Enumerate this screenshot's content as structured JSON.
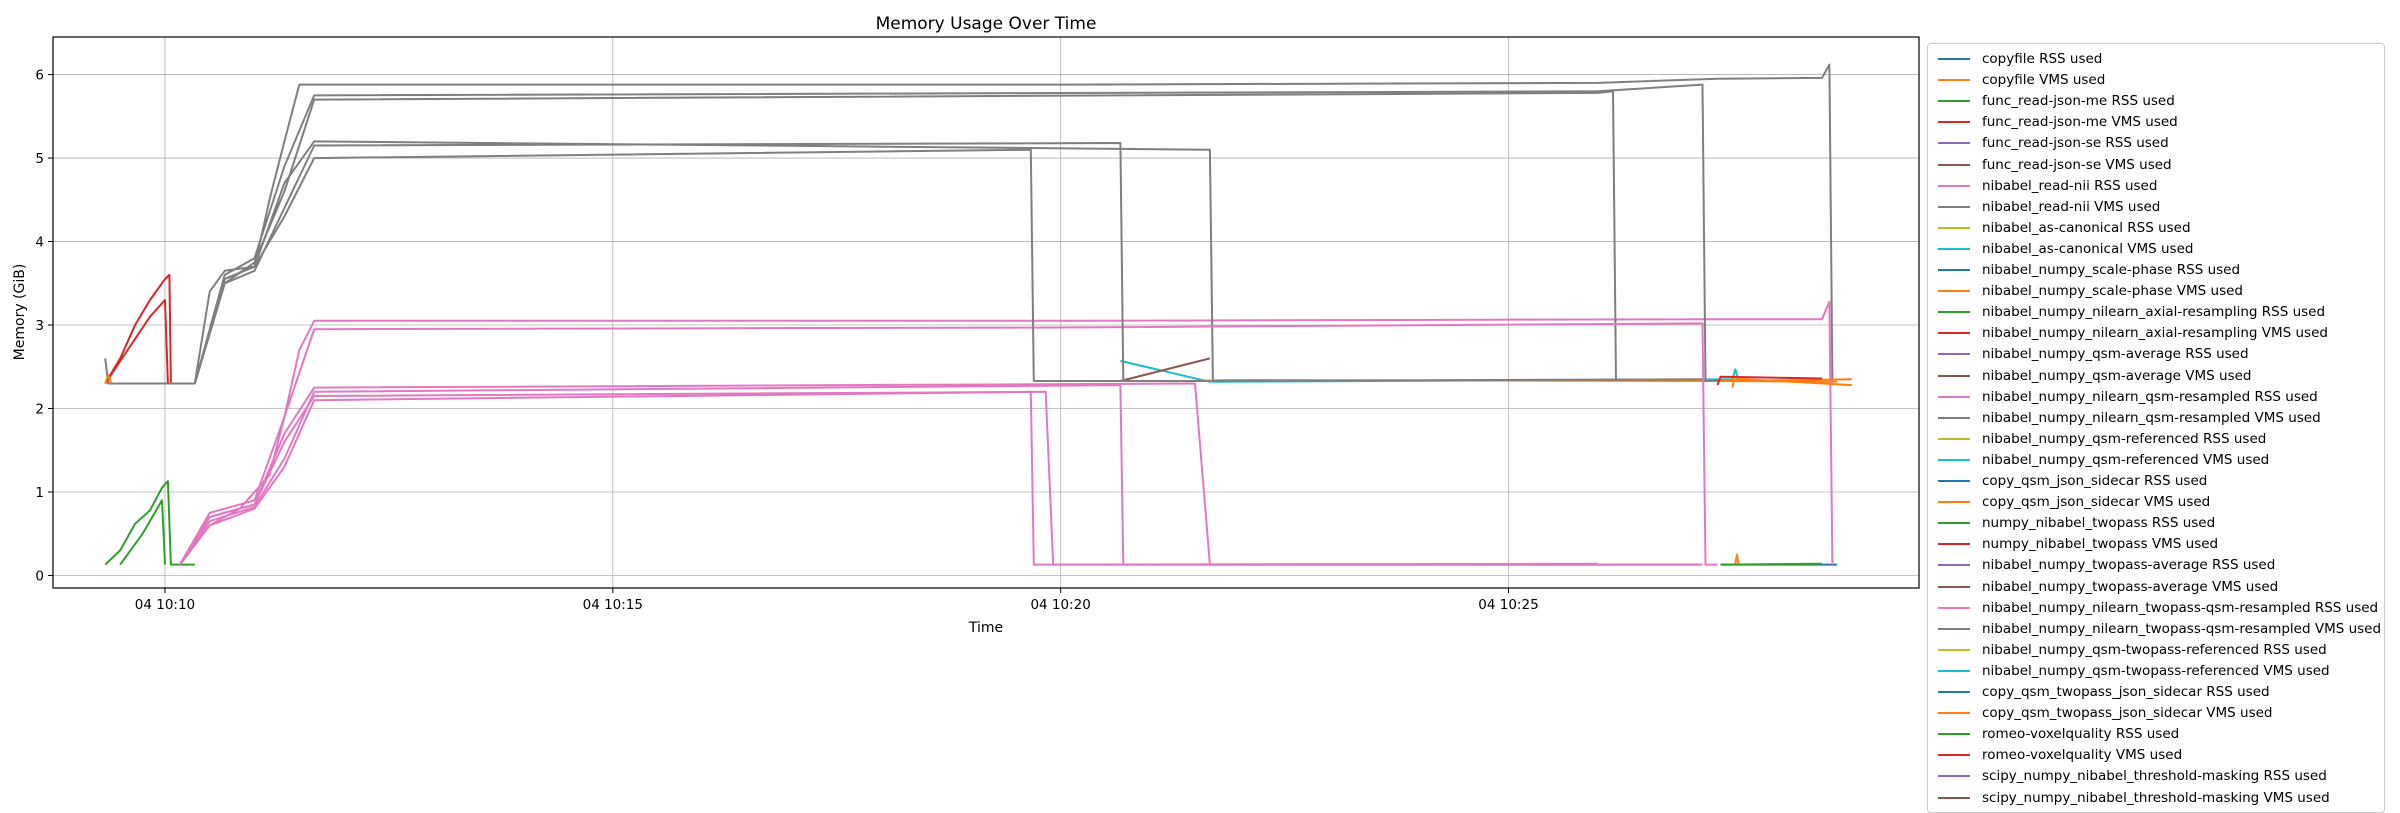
{
  "chart_data": {
    "type": "line",
    "title": "Memory Usage Over Time",
    "xlabel": "Time",
    "ylabel": "Memory (GiB)",
    "grid": true,
    "legend_placement": "outside-right",
    "xlim": [
      "04 10:08:45",
      "04 10:29:35"
    ],
    "ylim": [
      -0.15,
      6.45
    ],
    "xticks": [
      {
        "t": "04 10:10:00",
        "label": "04 10:10"
      },
      {
        "t": "04 10:15:00",
        "label": "04 10:15"
      },
      {
        "t": "04 10:20:00",
        "label": "04 10:20"
      },
      {
        "t": "04 10:25:00",
        "label": "04 10:25"
      }
    ],
    "yticks": [
      0,
      1,
      2,
      3,
      4,
      5,
      6
    ],
    "series": [
      {
        "name": "copyfile RSS used",
        "color": "#1f77b4",
        "points": [
          [
            "04 10:27:22",
            0.13
          ],
          [
            "04 10:28:40",
            0.13
          ]
        ]
      },
      {
        "name": "copyfile VMS used",
        "color": "#ff7f0e",
        "points": [
          [
            "04 10:27:22",
            2.33
          ],
          [
            "04 10:28:40",
            2.32
          ]
        ]
      },
      {
        "name": "func_read-json-me RSS used",
        "color": "#2ca02c",
        "points": [
          [
            "04 10:09:20",
            0.13
          ],
          [
            "04 10:09:30",
            0.3
          ],
          [
            "04 10:09:40",
            0.62
          ],
          [
            "04 10:09:50",
            0.78
          ],
          [
            "04 10:09:58",
            1.05
          ],
          [
            "04 10:10:02",
            1.13
          ],
          [
            "04 10:10:04",
            0.13
          ],
          [
            "04 10:10:20",
            0.13
          ]
        ]
      },
      {
        "name": "func_read-json-me VMS used",
        "color": "#d62728",
        "points": [
          [
            "04 10:09:20",
            2.3
          ],
          [
            "04 10:09:30",
            2.6
          ],
          [
            "04 10:09:40",
            3.0
          ],
          [
            "04 10:09:50",
            3.3
          ],
          [
            "04 10:10:00",
            3.55
          ],
          [
            "04 10:10:03",
            3.6
          ],
          [
            "04 10:10:04",
            2.3
          ],
          [
            "04 10:10:20",
            2.3
          ]
        ]
      },
      {
        "name": "func_read-json-se RSS used",
        "color": "#9467bd",
        "points": []
      },
      {
        "name": "func_read-json-se VMS used",
        "color": "#8c564b",
        "points": []
      },
      {
        "name": "nibabel_read-nii RSS used",
        "color": "#e377c2",
        "points": [
          [
            "04 10:10:10",
            0.13
          ],
          [
            "04 10:10:30",
            0.6
          ],
          [
            "04 10:10:50",
            0.8
          ],
          [
            "04 10:11:10",
            1.2
          ],
          [
            "04 10:11:20",
            1.9
          ],
          [
            "04 10:11:30",
            2.7
          ],
          [
            "04 10:11:40",
            3.05
          ],
          [
            "04 10:20:00",
            3.05
          ],
          [
            "04 10:27:20",
            3.07
          ],
          [
            "04 10:28:30",
            3.07
          ],
          [
            "04 10:28:35",
            3.28
          ],
          [
            "04 10:28:37",
            0.13
          ]
        ]
      },
      {
        "name": "nibabel_read-nii VMS used",
        "color": "#7f7f7f",
        "points": [
          [
            "04 10:09:20",
            2.6
          ],
          [
            "04 10:09:22",
            2.3
          ],
          [
            "04 10:10:20",
            2.3
          ],
          [
            "04 10:10:30",
            3.4
          ],
          [
            "04 10:10:40",
            3.65
          ],
          [
            "04 10:11:00",
            3.7
          ],
          [
            "04 10:11:10",
            4.5
          ],
          [
            "04 10:11:20",
            5.2
          ],
          [
            "04 10:11:30",
            5.88
          ],
          [
            "04 10:20:00",
            5.88
          ],
          [
            "04 10:26:00",
            5.9
          ],
          [
            "04 10:27:20",
            5.95
          ],
          [
            "04 10:28:30",
            5.96
          ],
          [
            "04 10:28:35",
            6.12
          ],
          [
            "04 10:28:37",
            2.33
          ]
        ]
      },
      {
        "name": "nibabel_as-canonical RSS used",
        "color": "#bcbd22",
        "points": []
      },
      {
        "name": "nibabel_as-canonical VMS used",
        "color": "#17becf",
        "points": [
          [
            "04 10:20:40",
            2.57
          ],
          [
            "04 10:21:40",
            2.32
          ],
          [
            "04 10:27:30",
            2.35
          ],
          [
            "04 10:27:32",
            2.47
          ],
          [
            "04 10:27:34",
            2.33
          ]
        ]
      },
      {
        "name": "nibabel_numpy_scale-phase RSS used",
        "color": "#1f77b4",
        "points": []
      },
      {
        "name": "nibabel_numpy_scale-phase VMS used",
        "color": "#ff7f0e",
        "points": [
          [
            "04 10:21:30",
            2.33
          ],
          [
            "04 10:21:50",
            2.34
          ],
          [
            "04 10:27:30",
            2.33
          ],
          [
            "04 10:28:50",
            2.35
          ]
        ]
      },
      {
        "name": "nibabel_numpy_nilearn_axial-resampling RSS used",
        "color": "#2ca02c",
        "points": []
      },
      {
        "name": "nibabel_numpy_nilearn_axial-resampling VMS used",
        "color": "#d62728",
        "points": [
          [
            "04 10:27:20",
            2.28
          ],
          [
            "04 10:27:22",
            2.38
          ],
          [
            "04 10:28:30",
            2.36
          ]
        ]
      },
      {
        "name": "nibabel_numpy_qsm-average RSS used",
        "color": "#9467bd",
        "points": []
      },
      {
        "name": "nibabel_numpy_qsm-average VMS used",
        "color": "#8c564b",
        "points": [
          [
            "04 10:20:40",
            2.33
          ],
          [
            "04 10:21:40",
            2.6
          ]
        ]
      },
      {
        "name": "nibabel_numpy_nilearn_qsm-resampled RSS used",
        "color": "#e377c2",
        "points": [
          [
            "04 10:10:10",
            0.13
          ],
          [
            "04 10:10:30",
            0.7
          ],
          [
            "04 10:11:00",
            0.85
          ],
          [
            "04 10:11:20",
            1.6
          ],
          [
            "04 10:11:40",
            2.15
          ],
          [
            "04 10:19:50",
            2.2
          ],
          [
            "04 10:19:55",
            0.13
          ],
          [
            "04 10:26:10",
            0.13
          ]
        ]
      },
      {
        "name": "nibabel_numpy_nilearn_qsm-resampled VMS used",
        "color": "#7f7f7f",
        "points": [
          [
            "04 10:10:20",
            2.3
          ],
          [
            "04 10:10:40",
            3.5
          ],
          [
            "04 10:11:00",
            3.75
          ],
          [
            "04 10:11:20",
            4.6
          ],
          [
            "04 10:11:40",
            5.7
          ],
          [
            "04 10:26:00",
            5.78
          ],
          [
            "04 10:26:10",
            5.8
          ],
          [
            "04 10:26:12",
            2.33
          ]
        ]
      },
      {
        "name": "nibabel_numpy_qsm-referenced RSS used",
        "color": "#bcbd22",
        "points": []
      },
      {
        "name": "nibabel_numpy_qsm-referenced VMS used",
        "color": "#17becf",
        "points": []
      },
      {
        "name": "copy_qsm_json_sidecar RSS used",
        "color": "#1f77b4",
        "points": []
      },
      {
        "name": "copy_qsm_json_sidecar VMS used",
        "color": "#ff7f0e",
        "points": [
          [
            "04 10:27:30",
            2.36
          ],
          [
            "04 10:28:50",
            2.28
          ]
        ]
      },
      {
        "name": "numpy_nibabel_twopass RSS used",
        "color": "#2ca02c",
        "points": []
      },
      {
        "name": "numpy_nibabel_twopass VMS used",
        "color": "#d62728",
        "points": []
      },
      {
        "name": "nibabel_numpy_twopass-average RSS used",
        "color": "#9467bd",
        "points": []
      },
      {
        "name": "nibabel_numpy_twopass-average VMS used",
        "color": "#8c564b",
        "points": []
      },
      {
        "name": "nibabel_numpy_nilearn_twopass-qsm-resampled RSS used",
        "color": "#e377c2",
        "points": [
          [
            "04 10:10:10",
            0.13
          ],
          [
            "04 10:10:30",
            0.7
          ],
          [
            "04 10:11:00",
            0.85
          ],
          [
            "04 10:11:20",
            1.7
          ],
          [
            "04 10:11:40",
            2.25
          ],
          [
            "04 10:21:30",
            2.3
          ],
          [
            "04 10:21:40",
            0.13
          ],
          [
            "04 10:27:10",
            0.13
          ]
        ]
      },
      {
        "name": "nibabel_numpy_nilearn_twopass-qsm-resampled VMS used",
        "color": "#7f7f7f",
        "points": [
          [
            "04 10:10:20",
            2.3
          ],
          [
            "04 10:10:40",
            3.55
          ],
          [
            "04 10:11:00",
            3.7
          ],
          [
            "04 10:11:20",
            4.7
          ],
          [
            "04 10:11:40",
            5.2
          ],
          [
            "04 10:21:40",
            5.1
          ],
          [
            "04 10:21:42",
            2.33
          ],
          [
            "04 10:27:10",
            2.35
          ]
        ]
      },
      {
        "name": "nibabel_numpy_qsm-twopass-referenced RSS used",
        "color": "#bcbd22",
        "points": []
      },
      {
        "name": "nibabel_numpy_qsm-twopass-referenced VMS used",
        "color": "#17becf",
        "points": []
      },
      {
        "name": "copy_qsm_twopass_json_sidecar RSS used",
        "color": "#1f77b4",
        "points": []
      },
      {
        "name": "copy_qsm_twopass_json_sidecar VMS used",
        "color": "#ff7f0e",
        "points": [
          [
            "04 10:27:30",
            2.25
          ],
          [
            "04 10:27:31",
            2.34
          ]
        ]
      },
      {
        "name": "romeo-voxelquality RSS used",
        "color": "#2ca02c",
        "points": [
          [
            "04 10:27:22",
            0.13
          ],
          [
            "04 10:28:30",
            0.14
          ]
        ]
      },
      {
        "name": "romeo-voxelquality VMS used",
        "color": "#d62728",
        "points": []
      },
      {
        "name": "scipy_numpy_nibabel_threshold-masking RSS used",
        "color": "#9467bd",
        "points": []
      },
      {
        "name": "scipy_numpy_nibabel_threshold-masking VMS used",
        "color": "#8c564b",
        "points": []
      },
      {
        "name": "",
        "color": "#e377c2",
        "points": [
          [
            "04 10:10:10",
            0.13
          ],
          [
            "04 10:10:30",
            0.75
          ],
          [
            "04 10:11:00",
            0.9
          ],
          [
            "04 10:11:20",
            1.9
          ],
          [
            "04 10:11:40",
            2.95
          ],
          [
            "04 10:20:00",
            2.97
          ],
          [
            "04 10:27:10",
            3.02
          ],
          [
            "04 10:27:12",
            0.13
          ],
          [
            "04 10:27:20",
            0.13
          ]
        ]
      },
      {
        "name": "",
        "color": "#7f7f7f",
        "points": [
          [
            "04 10:10:20",
            2.3
          ],
          [
            "04 10:10:40",
            3.6
          ],
          [
            "04 10:11:00",
            3.8
          ],
          [
            "04 10:11:20",
            4.9
          ],
          [
            "04 10:11:40",
            5.75
          ],
          [
            "04 10:26:00",
            5.8
          ],
          [
            "04 10:27:10",
            5.88
          ],
          [
            "04 10:27:12",
            2.33
          ],
          [
            "04 10:27:20",
            2.34
          ]
        ]
      },
      {
        "name": "",
        "color": "#e377c2",
        "points": [
          [
            "04 10:10:10",
            0.13
          ],
          [
            "04 10:10:30",
            0.65
          ],
          [
            "04 10:11:00",
            0.82
          ],
          [
            "04 10:11:20",
            1.4
          ],
          [
            "04 10:11:40",
            2.2
          ],
          [
            "04 10:20:40",
            2.28
          ],
          [
            "04 10:20:42",
            0.13
          ],
          [
            "04 10:27:10",
            0.13
          ]
        ]
      },
      {
        "name": "",
        "color": "#7f7f7f",
        "points": [
          [
            "04 10:10:20",
            2.3
          ],
          [
            "04 10:10:40",
            3.5
          ],
          [
            "04 10:11:00",
            3.65
          ],
          [
            "04 10:11:20",
            4.4
          ],
          [
            "04 10:11:40",
            5.15
          ],
          [
            "04 10:20:40",
            5.18
          ],
          [
            "04 10:20:42",
            2.33
          ],
          [
            "04 10:21:40",
            2.33
          ]
        ]
      },
      {
        "name": "",
        "color": "#e377c2",
        "points": [
          [
            "04 10:10:10",
            0.13
          ],
          [
            "04 10:10:30",
            0.6
          ],
          [
            "04 10:11:00",
            0.8
          ],
          [
            "04 10:11:20",
            1.3
          ],
          [
            "04 10:11:40",
            2.1
          ],
          [
            "04 10:19:40",
            2.2
          ],
          [
            "04 10:19:42",
            0.13
          ],
          [
            "04 10:26:00",
            0.14
          ]
        ]
      },
      {
        "name": "",
        "color": "#7f7f7f",
        "points": [
          [
            "04 10:10:20",
            2.3
          ],
          [
            "04 10:10:40",
            3.55
          ],
          [
            "04 10:11:00",
            3.7
          ],
          [
            "04 10:11:20",
            4.3
          ],
          [
            "04 10:11:40",
            5.0
          ],
          [
            "04 10:19:40",
            5.1
          ],
          [
            "04 10:19:42",
            2.33
          ],
          [
            "04 10:20:40",
            2.33
          ]
        ]
      },
      {
        "name": "",
        "color": "#ff7f0e",
        "points": [
          [
            "04 10:27:32",
            0.14
          ],
          [
            "04 10:27:33",
            0.25
          ],
          [
            "04 10:27:34",
            0.14
          ]
        ]
      },
      {
        "name": "",
        "color": "#d62728",
        "points": [
          [
            "04 10:09:20",
            2.3
          ],
          [
            "04 10:09:35",
            2.7
          ],
          [
            "04 10:09:50",
            3.1
          ],
          [
            "04 10:10:00",
            3.3
          ],
          [
            "04 10:10:02",
            2.3
          ]
        ]
      },
      {
        "name": "",
        "color": "#ff7f0e",
        "points": [
          [
            "04 10:09:20",
            2.3
          ],
          [
            "04 10:09:22",
            2.4
          ],
          [
            "04 10:09:24",
            2.3
          ]
        ]
      },
      {
        "name": "",
        "color": "#2ca02c",
        "points": [
          [
            "04 10:09:30",
            0.13
          ],
          [
            "04 10:09:45",
            0.5
          ],
          [
            "04 10:09:58",
            0.9
          ],
          [
            "04 10:10:00",
            0.13
          ]
        ]
      }
    ]
  }
}
